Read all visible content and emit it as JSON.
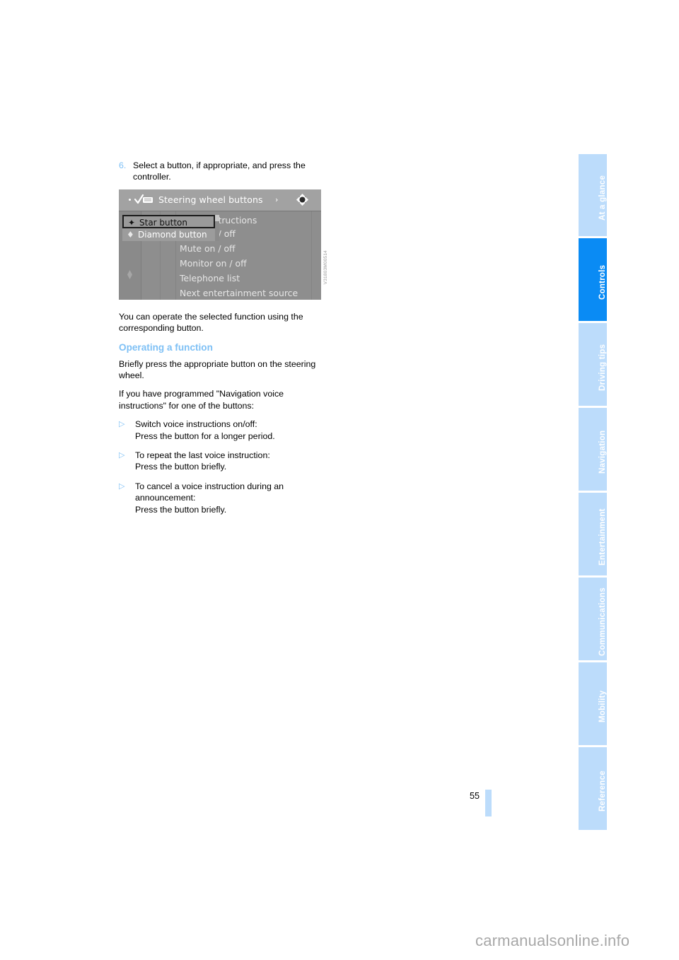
{
  "page": {
    "number": "55",
    "watermark": "carmanualsonline.info"
  },
  "step": {
    "number": "6.",
    "text": "Select a button, if appropriate, and press the controller."
  },
  "device_screenshot": {
    "figure_id": "V31803M00514",
    "titlebar": {
      "title": "Steering wheel buttons",
      "left_arrow": "‹",
      "right_arrow": "›",
      "check_icon": "check-steering-wheel-icon",
      "controller_icon": "controller-icon"
    },
    "popup": {
      "items": [
        {
          "glyph": "✦",
          "label": "Star button",
          "selected": true
        },
        {
          "glyph": "♦",
          "label": "Diamond button",
          "selected": false
        }
      ]
    },
    "menu_items": [
      "voice instructions",
      "ation on / off",
      "Mute on / off",
      "Monitor on / off",
      "Telephone list",
      "Next entertainment source"
    ],
    "rail_glyph": "♦"
  },
  "paragraphs": {
    "after_figure": "You can operate the selected function using the corresponding button."
  },
  "section": {
    "heading": "Operating a function",
    "para1": "Briefly press the appropriate button on the steering wheel.",
    "para2": "If you have programmed \"Navigation voice instructions\" for one of the buttons:"
  },
  "bullets": [
    {
      "marker": "▷",
      "line1": "Switch voice instructions on/off:",
      "line2": "Press the button for a longer period."
    },
    {
      "marker": "▷",
      "line1": "To repeat the last voice instruction:",
      "line2": "Press the button briefly."
    },
    {
      "marker": "▷",
      "line1": "To cancel a voice instruction during an announcement:",
      "line2": "Press the button briefly."
    }
  ],
  "sidebar": {
    "tabs": [
      {
        "label": "At a glance",
        "active": false
      },
      {
        "label": "Controls",
        "active": true
      },
      {
        "label": "Driving tips",
        "active": false
      },
      {
        "label": "Navigation",
        "active": false
      },
      {
        "label": "Entertainment",
        "active": false
      },
      {
        "label": "Communications",
        "active": false
      },
      {
        "label": "Mobility",
        "active": false
      },
      {
        "label": "Reference",
        "active": false
      }
    ]
  },
  "colors": {
    "accent_blue": "#7ec0f5",
    "tab_inactive": "#bcdcfb",
    "tab_active": "#0a8bf4",
    "text": "#000000"
  }
}
